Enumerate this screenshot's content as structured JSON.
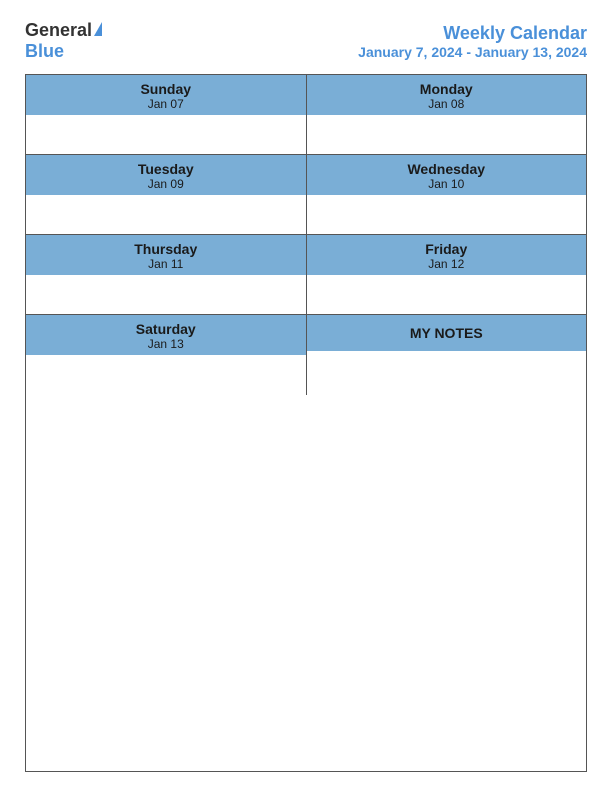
{
  "header": {
    "logo": {
      "general": "General",
      "blue": "Blue",
      "triangle": "▶"
    },
    "title": "Weekly Calendar",
    "date_range": "January 7, 2024 - January 13, 2024"
  },
  "calendar": {
    "rows": [
      {
        "cells": [
          {
            "day": "Sunday",
            "date": "Jan 07"
          },
          {
            "day": "Monday",
            "date": "Jan 08"
          }
        ]
      },
      {
        "cells": [
          {
            "day": "Tuesday",
            "date": "Jan 09"
          },
          {
            "day": "Wednesday",
            "date": "Jan 10"
          }
        ]
      },
      {
        "cells": [
          {
            "day": "Thursday",
            "date": "Jan 11"
          },
          {
            "day": "Friday",
            "date": "Jan 12"
          }
        ]
      },
      {
        "cells": [
          {
            "day": "Saturday",
            "date": "Jan 13"
          },
          {
            "day": null,
            "date": null,
            "notes": "MY NOTES"
          }
        ]
      }
    ]
  }
}
